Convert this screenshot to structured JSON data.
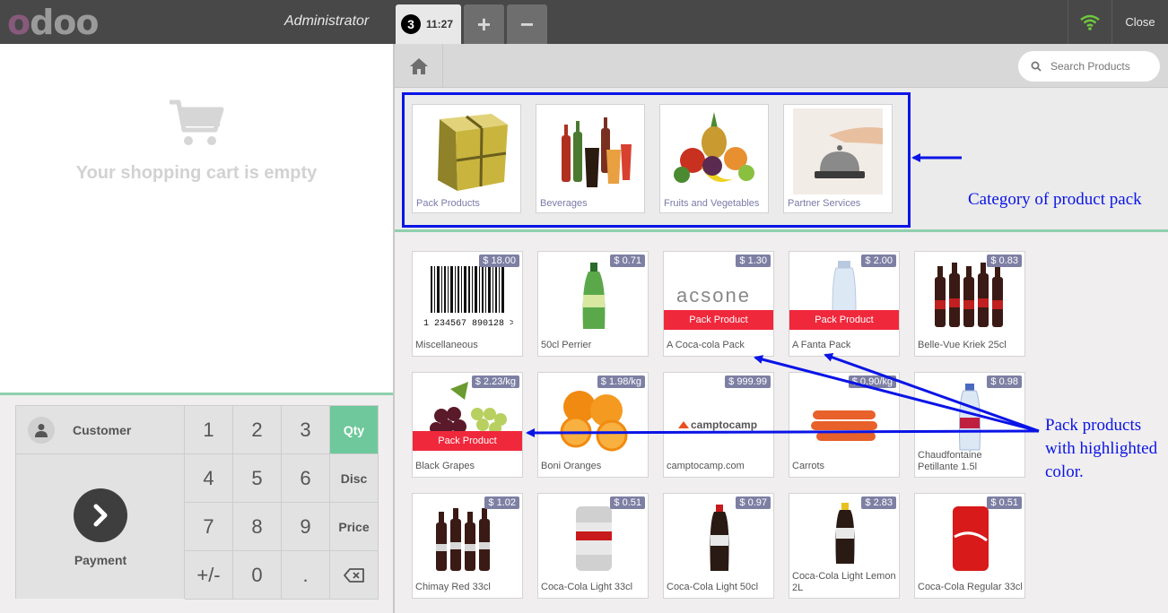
{
  "header": {
    "logo": "odoo",
    "user": "Administrator",
    "order_number": "3",
    "order_time": "11:27",
    "add_order_label": "+",
    "remove_order_label": "−",
    "close_label": "Close"
  },
  "cart": {
    "empty_message": "Your shopping cart is empty"
  },
  "numpad": {
    "customer_label": "Customer",
    "payment_label": "Payment",
    "keys": [
      "1",
      "2",
      "3",
      "4",
      "5",
      "6",
      "7",
      "8",
      "9",
      "+/-",
      "0",
      "."
    ],
    "modes": [
      "Qty",
      "Disc",
      "Price"
    ],
    "active_mode": "Qty"
  },
  "search": {
    "placeholder": "Search Products"
  },
  "categories": [
    {
      "label": "Pack Products"
    },
    {
      "label": "Beverages"
    },
    {
      "label": "Fruits and Vegetables"
    },
    {
      "label": "Partner Services"
    }
  ],
  "products": [
    {
      "name": "Miscellaneous",
      "price": "$ 18.00"
    },
    {
      "name": "50cl Perrier",
      "price": "$ 0.71"
    },
    {
      "name": "A Coca-cola Pack",
      "price": "$ 1.30",
      "badge": "Pack Product",
      "logo": "acsone"
    },
    {
      "name": "A Fanta Pack",
      "price": "$ 2.00",
      "badge": "Pack Product"
    },
    {
      "name": "Belle-Vue Kriek 25cl",
      "price": "$ 0.83"
    },
    {
      "name": "Black Grapes",
      "price": "$ 2.23/kg",
      "badge": "Pack Product"
    },
    {
      "name": "Boni Oranges",
      "price": "$ 1.98/kg"
    },
    {
      "name": "camptocamp.com",
      "price": "$ 999.99",
      "logo": "camptocamp"
    },
    {
      "name": "Carrots",
      "price": "$ 0.90/kg"
    },
    {
      "name": "Chaudfontaine Petillante 1.5l",
      "price": "$ 0.98"
    },
    {
      "name": "Chimay Red 33cl",
      "price": "$ 1.02"
    },
    {
      "name": "Coca-Cola Light 33cl",
      "price": "$ 0.51"
    },
    {
      "name": "Coca-Cola Light 50cl",
      "price": "$ 0.97"
    },
    {
      "name": "Coca-Cola Light Lemon 2L",
      "price": "$ 2.83"
    },
    {
      "name": "Coca-Cola Regular 33cl",
      "price": "$ 0.51"
    }
  ],
  "annotations": {
    "category_note": "Category of product pack",
    "pack_note_line1": "Pack products",
    "pack_note_line2": "with highlighted",
    "pack_note_line3": "color.",
    "annotation_color": "#0a14e6"
  },
  "colors": {
    "accent_green": "#6ec89b",
    "badge_red": "#f0283c",
    "price_tag": "#7d7fa3",
    "topbar": "#484848"
  }
}
